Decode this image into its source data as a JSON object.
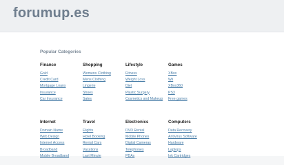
{
  "site": {
    "logo": "forumup.es"
  },
  "section_title": "Popular Categories",
  "rows": [
    [
      {
        "title": "Finance",
        "links": [
          "Gold",
          "Credit Card",
          "Mortgage Loans",
          "Insurance",
          "Car Insurance"
        ]
      },
      {
        "title": "Shopping",
        "links": [
          "Womens Clothing",
          "Mens Clothing",
          "Lingerie",
          "Shoes",
          "Sales"
        ]
      },
      {
        "title": "Lifestyle",
        "links": [
          "Fitness",
          "Weight Loss",
          "Diet",
          "Plastic Surgery",
          "Cosmetics and Makeup"
        ]
      },
      {
        "title": "Games",
        "links": [
          "XBox",
          "Wii",
          "XBox360",
          "PS3",
          "Free games"
        ]
      }
    ],
    [
      {
        "title": "Internet",
        "links": [
          "Domain Name",
          "Web Design",
          "Internet Access",
          "Broadband",
          "Mobile Broadband"
        ]
      },
      {
        "title": "Travel",
        "links": [
          "Flights",
          "Hotel Booking",
          "Rental Cars",
          "Vacations",
          "Last Minute"
        ]
      },
      {
        "title": "Electronics",
        "links": [
          "DVD Rental",
          "Mobile Phones",
          "Digital Cameras",
          "Telephones",
          "PDAs"
        ]
      },
      {
        "title": "Computers",
        "links": [
          "Data Recovery",
          "Antivirus Software",
          "Hardware",
          "Laptops",
          "Ink Cartridges"
        ]
      }
    ]
  ]
}
